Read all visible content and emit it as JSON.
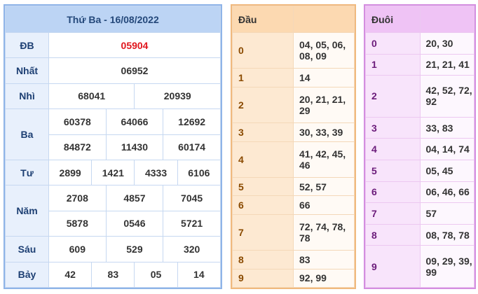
{
  "results": {
    "title": "Thứ Ba - 16/08/2022",
    "prizes": {
      "db": {
        "label": "ĐB",
        "numbers": [
          "05904"
        ]
      },
      "nhat": {
        "label": "Nhất",
        "numbers": [
          "06952"
        ]
      },
      "nhi": {
        "label": "Nhì",
        "numbers": [
          "68041",
          "20939"
        ]
      },
      "ba": {
        "label": "Ba",
        "numbers": [
          "60378",
          "64066",
          "12692",
          "84872",
          "11430",
          "60174"
        ]
      },
      "tu": {
        "label": "Tư",
        "numbers": [
          "2899",
          "1421",
          "4333",
          "6106"
        ]
      },
      "nam": {
        "label": "Năm",
        "numbers": [
          "2708",
          "4857",
          "7045",
          "5878",
          "0546",
          "5721"
        ]
      },
      "sau": {
        "label": "Sáu",
        "numbers": [
          "609",
          "529",
          "320"
        ]
      },
      "bay": {
        "label": "Bảy",
        "numbers": [
          "42",
          "83",
          "05",
          "14"
        ]
      }
    },
    "colors": {
      "special": "#e0161d",
      "header_bg": "#bcd4f4",
      "border": "#8fb4e8"
    }
  },
  "dau": {
    "title": "Đầu",
    "rows": [
      {
        "key": "0",
        "values": "04, 05, 06, 08, 09"
      },
      {
        "key": "1",
        "values": "14"
      },
      {
        "key": "2",
        "values": "20, 21, 21, 29"
      },
      {
        "key": "3",
        "values": "30, 33, 39"
      },
      {
        "key": "4",
        "values": "41, 42, 45, 46"
      },
      {
        "key": "5",
        "values": "52, 57"
      },
      {
        "key": "6",
        "values": "66"
      },
      {
        "key": "7",
        "values": "72, 74, 78, 78"
      },
      {
        "key": "8",
        "values": "83"
      },
      {
        "key": "9",
        "values": "92, 99"
      }
    ],
    "colors": {
      "header_bg": "#fcd9b1",
      "border": "#f0b97e"
    }
  },
  "duoi": {
    "title": "Đuôi",
    "rows": [
      {
        "key": "0",
        "values": "20, 30"
      },
      {
        "key": "1",
        "values": "21, 21, 41"
      },
      {
        "key": "2",
        "values": "42, 52, 72, 92"
      },
      {
        "key": "3",
        "values": "33, 83"
      },
      {
        "key": "4",
        "values": "04, 14, 74"
      },
      {
        "key": "5",
        "values": "05, 45"
      },
      {
        "key": "6",
        "values": "06, 46, 66"
      },
      {
        "key": "7",
        "values": "57"
      },
      {
        "key": "8",
        "values": "08, 78, 78"
      },
      {
        "key": "9",
        "values": "09, 29, 39, 99"
      }
    ],
    "colors": {
      "header_bg": "#efc3f5",
      "border": "#d48ee0"
    }
  }
}
